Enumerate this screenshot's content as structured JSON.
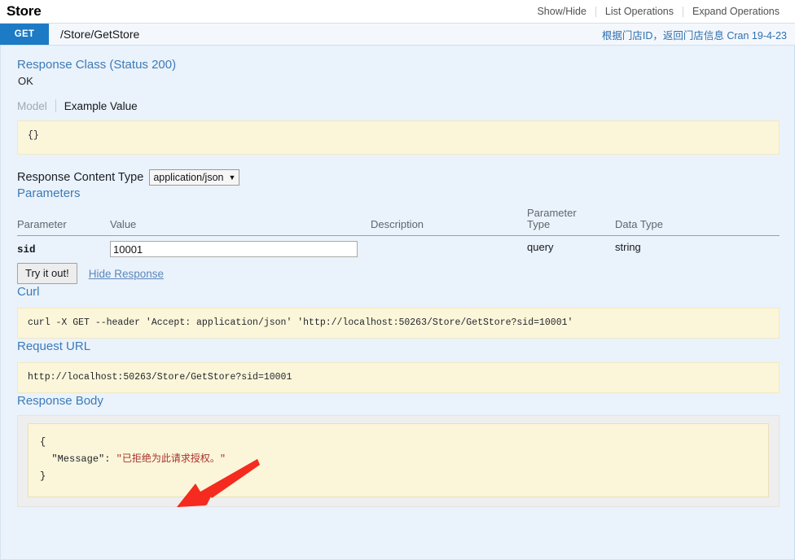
{
  "resource": {
    "title": "Store",
    "options": [
      {
        "label": "Show/Hide"
      },
      {
        "label": "List Operations"
      },
      {
        "label": "Expand Operations"
      }
    ]
  },
  "operation": {
    "method": "GET",
    "path": "/Store/GetStore",
    "summary": "根据门店ID，返回门店信息 Cran 19-4-23",
    "method_color": "#1d7ac4"
  },
  "response_class": {
    "heading": "Response Class (Status 200)",
    "status_text": "OK",
    "tabs": {
      "model": "Model",
      "example_value": "Example Value"
    },
    "example_value": "{}"
  },
  "response_content_type": {
    "label": "Response Content Type",
    "selected": "application/json",
    "caret": "▼",
    "options": [
      "application/json"
    ]
  },
  "parameters": {
    "heading": "Parameters",
    "columns": [
      "Parameter",
      "Value",
      "Description",
      "Parameter Type",
      "Data Type"
    ],
    "columns_ptype_line1": "Parameter",
    "columns_ptype_line2": "Type",
    "rows": [
      {
        "name": "sid",
        "value": "10001",
        "description": "",
        "parameter_type": "query",
        "data_type": "string"
      }
    ],
    "try_it_out_label": "Try it out!",
    "hide_response_label": "Hide Response"
  },
  "curl": {
    "heading": "Curl",
    "command": "curl -X GET --header 'Accept: application/json' 'http://localhost:50263/Store/GetStore?sid=10001'"
  },
  "request_url": {
    "heading": "Request URL",
    "url": "http://localhost:50263/Store/GetStore?sid=10001"
  },
  "response_body": {
    "heading": "Response Body",
    "open_brace": "{",
    "key": "\"Message\":",
    "value": "\"已拒绝为此请求授权。\"",
    "close_brace": "}"
  },
  "annotation": {
    "arrow_color": "#f42b1e"
  },
  "colors": {
    "panel_bg": "#eaf2fb",
    "code_bg": "#fbf6da",
    "heading_blue": "#3c7bb8",
    "link_blue": "#5b88b8",
    "error_red": "#a8312a"
  }
}
